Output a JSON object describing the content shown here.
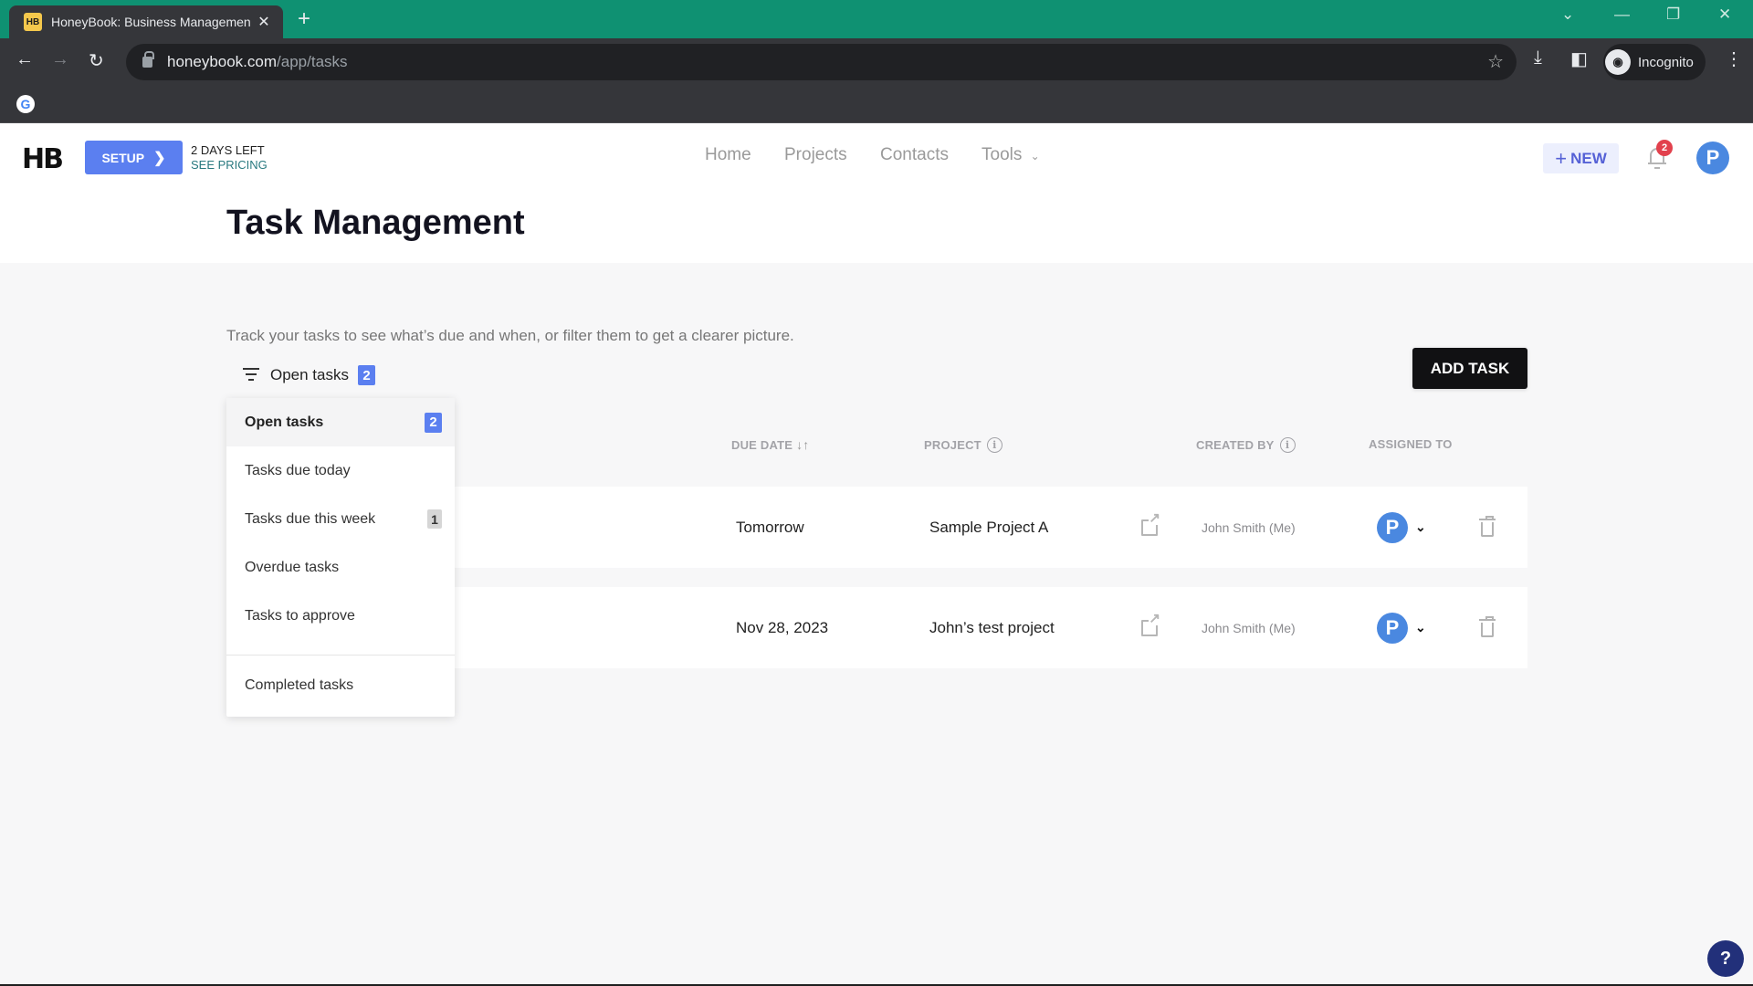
{
  "browser": {
    "tab_title": "HoneyBook: Business Management",
    "tab_favicon": "HB",
    "url_domain": "honeybook.com",
    "url_path": "/app/tasks",
    "profile_label": "Incognito",
    "accent_color": "#0f9172"
  },
  "header": {
    "logo": "HB",
    "setup_label": "SETUP",
    "trial_days": "2 DAYS LEFT",
    "see_pricing": "SEE PRICING",
    "nav": [
      {
        "label": "Home"
      },
      {
        "label": "Projects"
      },
      {
        "label": "Contacts"
      },
      {
        "label": "Tools"
      }
    ],
    "new_label": "NEW",
    "notification_count": "2",
    "avatar_initial": "P"
  },
  "page": {
    "title": "Task Management",
    "description": "Track your tasks to see what’s due and when, or filter them to get a clearer picture.",
    "add_task_label": "ADD TASK"
  },
  "filter": {
    "current_label": "Open tasks",
    "current_count": "2",
    "options": [
      {
        "label": "Open tasks",
        "count": "2",
        "active": true
      },
      {
        "label": "Tasks due today",
        "count": null
      },
      {
        "label": "Tasks due this week",
        "count": "1"
      },
      {
        "label": "Overdue tasks",
        "count": null
      },
      {
        "label": "Tasks to approve",
        "count": null
      },
      {
        "label": "Completed tasks",
        "count": null
      }
    ]
  },
  "table": {
    "columns": {
      "due_date": "DUE DATE",
      "project": "PROJECT",
      "created_by": "CREATED BY",
      "assigned_to": "ASSIGNED TO"
    },
    "rows": [
      {
        "due_date": "Tomorrow",
        "project": "Sample Project A",
        "created_by": "John Smith (Me)",
        "assignee_initial": "P"
      },
      {
        "due_date": "Nov 28, 2023",
        "project": "John’s test project",
        "created_by": "John Smith (Me)",
        "assignee_initial": "P"
      }
    ]
  },
  "help_label": "?"
}
